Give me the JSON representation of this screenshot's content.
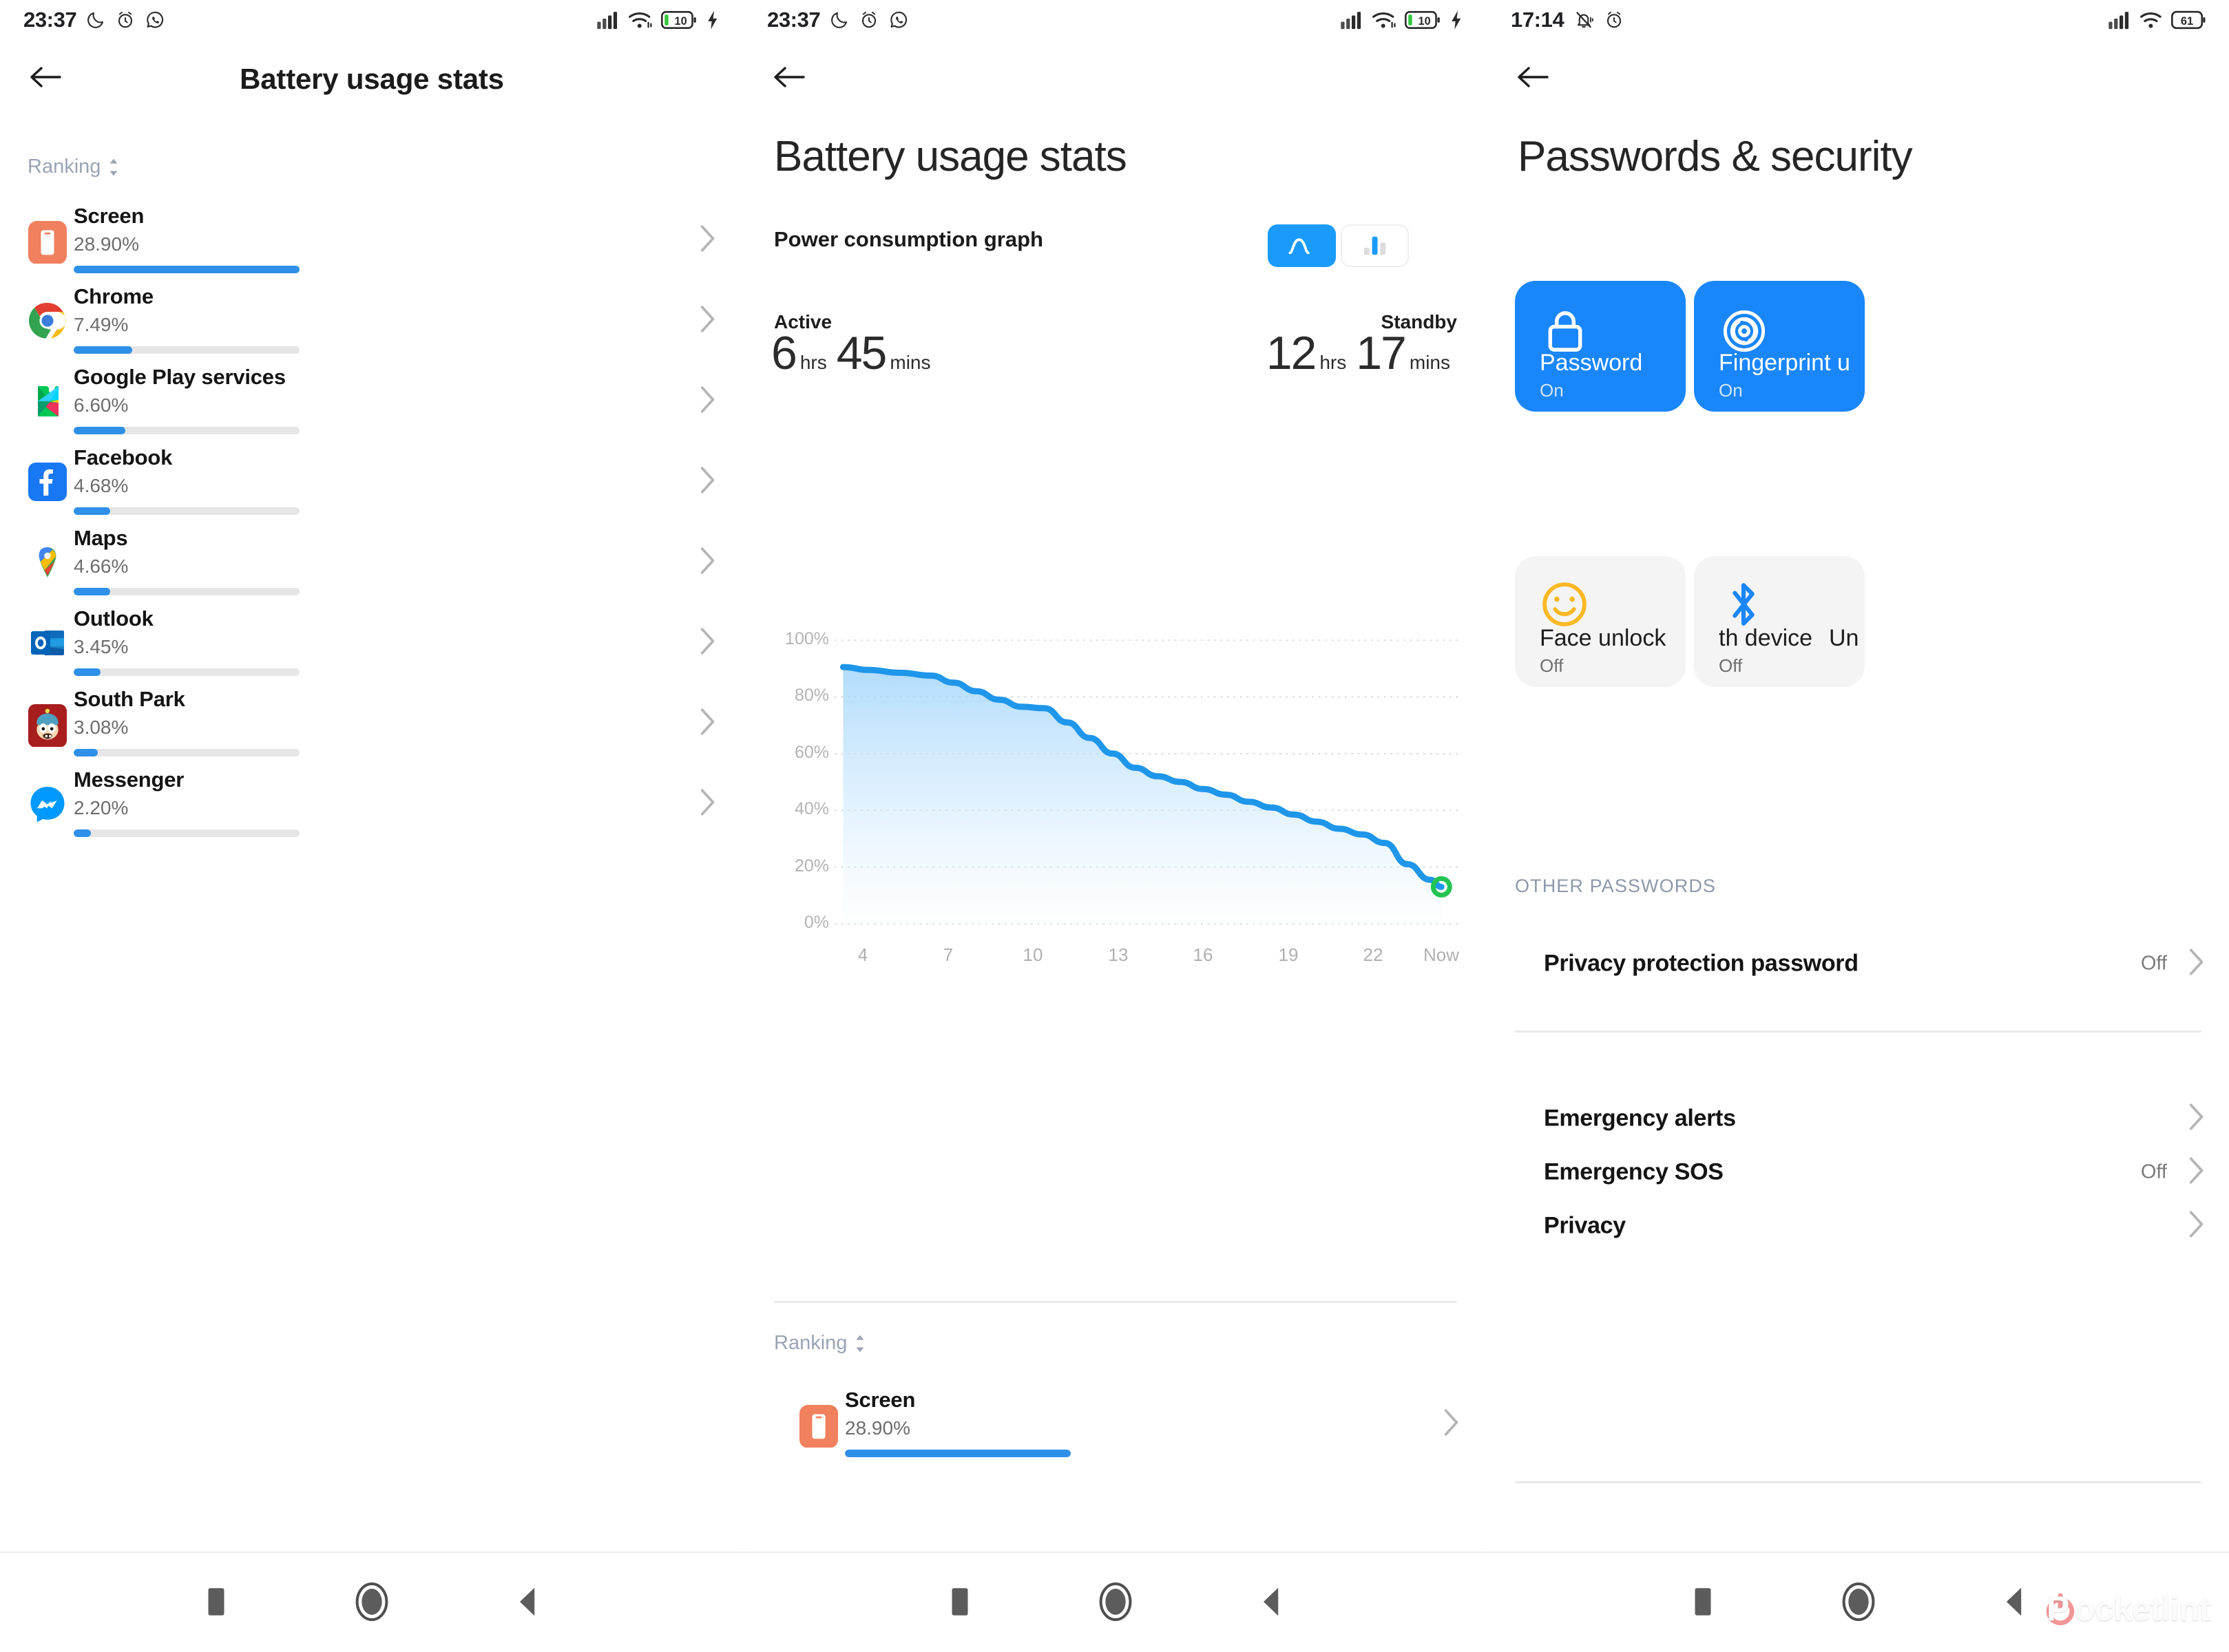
{
  "panels": {
    "left": {
      "status_bar": {
        "time": "23:37",
        "battery_level": "10",
        "icons": [
          "moon-icon",
          "alarm-icon",
          "whatsapp-icon",
          "signal-icon",
          "wifi-icon",
          "battery-icon",
          "charging-bolt-icon"
        ]
      },
      "back_label": "back-arrow",
      "title": "Battery usage stats",
      "ranking_label": "Ranking",
      "apps": [
        {
          "name": "Screen",
          "percent": "28.90%",
          "bar": 28.9,
          "icon": "screen-icon"
        },
        {
          "name": "Chrome",
          "percent": "7.49%",
          "bar": 7.49,
          "icon": "chrome-icon"
        },
        {
          "name": "Google Play services",
          "percent": "6.60%",
          "bar": 6.6,
          "icon": "google-play-services-icon"
        },
        {
          "name": "Facebook",
          "percent": "4.68%",
          "bar": 4.68,
          "icon": "facebook-icon"
        },
        {
          "name": "Maps",
          "percent": "4.66%",
          "bar": 4.66,
          "icon": "google-maps-icon"
        },
        {
          "name": "Outlook",
          "percent": "3.45%",
          "bar": 3.45,
          "icon": "outlook-icon"
        },
        {
          "name": "South Park",
          "percent": "3.08%",
          "bar": 3.08,
          "icon": "south-park-icon"
        },
        {
          "name": "Messenger",
          "percent": "2.20%",
          "bar": 2.2,
          "icon": "messenger-icon"
        }
      ]
    },
    "middle": {
      "status_bar": {
        "time": "23:37",
        "battery_level": "10"
      },
      "title": "Battery usage stats",
      "graph_card_label": "Power consumption graph",
      "toggle": {
        "line_label": "line-graph-toggle",
        "bar_label": "bar-graph-toggle",
        "selected": "line"
      },
      "active": {
        "label": "Active",
        "hours": "6",
        "hours_unit": "hrs",
        "mins": "45",
        "mins_unit": "mins"
      },
      "standby": {
        "label": "Standby",
        "hours": "12",
        "hours_unit": "hrs",
        "mins": "17",
        "mins_unit": "mins"
      },
      "ranking_label": "Ranking",
      "apps": [
        {
          "name": "Screen",
          "percent": "28.90%",
          "bar": 28.9,
          "icon": "screen-icon"
        }
      ]
    },
    "right": {
      "status_bar": {
        "time": "17:14",
        "battery_level": "61",
        "icons": [
          "mute-bell-icon",
          "alarm-icon",
          "signal-icon",
          "wifi-icon",
          "battery-icon"
        ]
      },
      "title": "Passwords & security",
      "tiles": [
        {
          "name": "Password",
          "status": "On",
          "style": "blue",
          "icon": "lock-icon"
        },
        {
          "name": "Fingerprint u",
          "status": "On",
          "style": "blue",
          "icon": "fingerprint-icon"
        },
        {
          "name": "Face unlock",
          "status": "Off",
          "style": "grey",
          "icon": "smiley-face-icon"
        },
        {
          "name": "th device",
          "status": "Off",
          "style": "grey",
          "icon": "bluetooth-icon",
          "extra": "Un"
        }
      ],
      "section_header": "OTHER PASSWORDS",
      "rows": [
        {
          "label": "Privacy protection password",
          "value": "Off"
        },
        {
          "label": "Emergency alerts",
          "value": ""
        },
        {
          "label": "Emergency SOS",
          "value": "Off"
        },
        {
          "label": "Privacy",
          "value": ""
        }
      ]
    }
  },
  "watermark": {
    "text": "ocketlint",
    "lead": "P"
  },
  "colors": {
    "accent": "#2e90e8",
    "tile_blue": "#1a86fb",
    "toggle_blue": "#1a9bfc",
    "chart_line": "#1e96ea",
    "screen_icon": "#f0805e",
    "battery_green": "#31c24d"
  },
  "chart_data": {
    "type": "area",
    "title": "Power consumption graph",
    "xlabel": "",
    "ylabel": "",
    "ylim": [
      0,
      100
    ],
    "xlim": [
      3,
      25
    ],
    "grid": true,
    "ytick_labels": [
      "100%",
      "80%",
      "60%",
      "40%",
      "20%",
      "0%"
    ],
    "ytick_values": [
      100,
      80,
      60,
      40,
      20,
      0
    ],
    "xtick_labels": [
      "4",
      "7",
      "10",
      "13",
      "16",
      "19",
      "22",
      "Now"
    ],
    "xtick_values": [
      4,
      7,
      10,
      13,
      16,
      19,
      22,
      24.4
    ],
    "series": [
      {
        "name": "Battery level",
        "x": [
          3.3,
          4.2,
          5.3,
          6.4,
          7.2,
          8.0,
          8.8,
          9.6,
          10.4,
          11.2,
          12.0,
          12.8,
          13.6,
          14.4,
          15.2,
          16.0,
          16.8,
          17.6,
          18.4,
          19.2,
          20.0,
          20.8,
          21.6,
          22.4,
          23.2,
          24.0,
          24.4
        ],
        "y": [
          90.5,
          89.5,
          88.5,
          87.5,
          85.0,
          82.0,
          79.0,
          76.5,
          76.0,
          71.0,
          65.5,
          60.0,
          55.0,
          52.0,
          50.0,
          47.5,
          45.5,
          43.0,
          41.0,
          38.5,
          36.0,
          33.5,
          31.5,
          28.5,
          21.0,
          15.5,
          13.0,
          9.0
        ]
      }
    ],
    "end_marker": {
      "label": "Now",
      "color": "#23c552",
      "value": 9
    }
  }
}
